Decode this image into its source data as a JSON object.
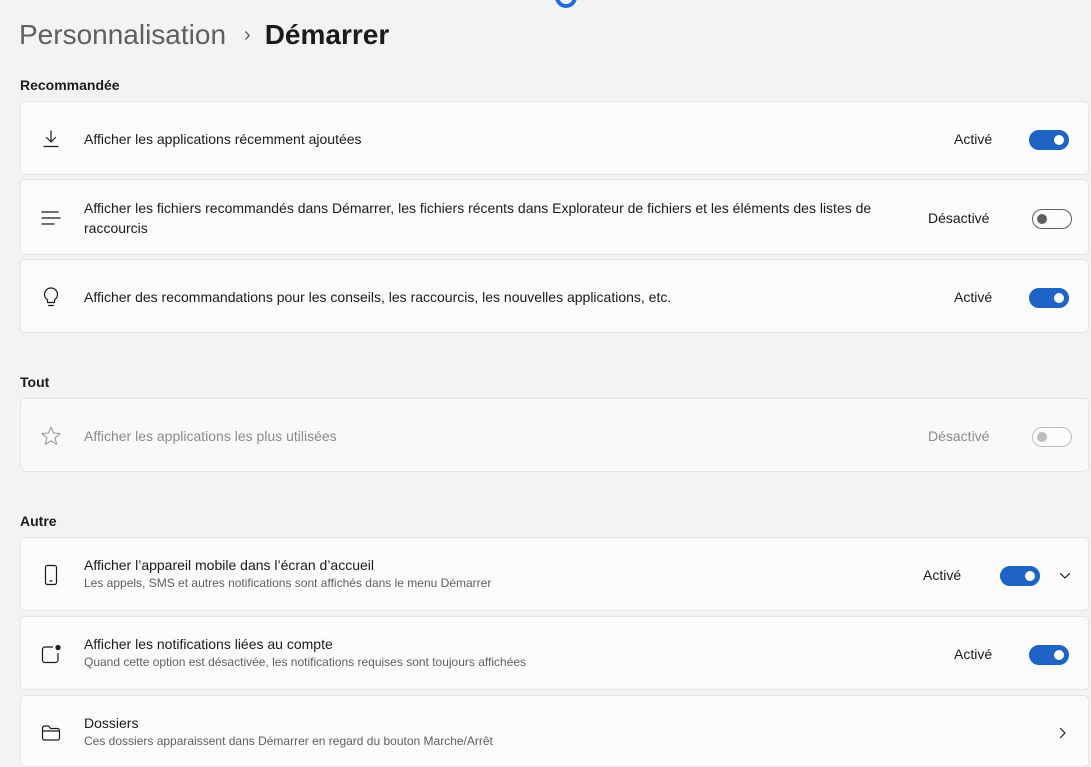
{
  "breadcrumb": {
    "parent": "Personnalisation",
    "separator": "›",
    "current": "Démarrer"
  },
  "sections": {
    "recommended": "Recommandée",
    "all": "Tout",
    "other": "Autre"
  },
  "settings": {
    "recent_apps": {
      "icon": "download-icon",
      "label": "Afficher les applications récemment ajoutées",
      "state": "Activé",
      "on": true
    },
    "recommended_files": {
      "icon": "lines-icon",
      "label": "Afficher les fichiers recommandés dans Démarrer, les fichiers récents dans Explorateur de fichiers et les éléments des listes de raccourcis",
      "state": "Désactivé",
      "on": false
    },
    "recommendations": {
      "icon": "lightbulb-icon",
      "label": "Afficher des recommandations pour les conseils, les raccourcis, les nouvelles applications, etc.",
      "state": "Activé",
      "on": true
    },
    "most_used": {
      "icon": "star-icon",
      "label": "Afficher les applications les plus utilisées",
      "state": "Désactivé",
      "on": false,
      "disabled": true
    },
    "mobile_device": {
      "icon": "phone-icon",
      "label": "Afficher l’appareil mobile dans l’écran d’accueil",
      "sub": "Les appels, SMS et autres notifications sont affichés dans le menu Démarrer",
      "state": "Activé",
      "on": true,
      "expandable": true
    },
    "account_notifications": {
      "icon": "notification-badge-icon",
      "label": "Afficher les notifications liées au compte",
      "sub": "Quand cette option est désactivée, les notifications requises sont toujours affichées",
      "state": "Activé",
      "on": true
    },
    "folders": {
      "icon": "folder-icon",
      "label": "Dossiers",
      "sub": "Ces dossiers apparaissent dans Démarrer en regard du bouton Marche/Arrêt",
      "navigable": true
    }
  },
  "colors": {
    "accent": "#1f63c6",
    "background": "#f3f3f3",
    "card": "#fbfbfb"
  }
}
